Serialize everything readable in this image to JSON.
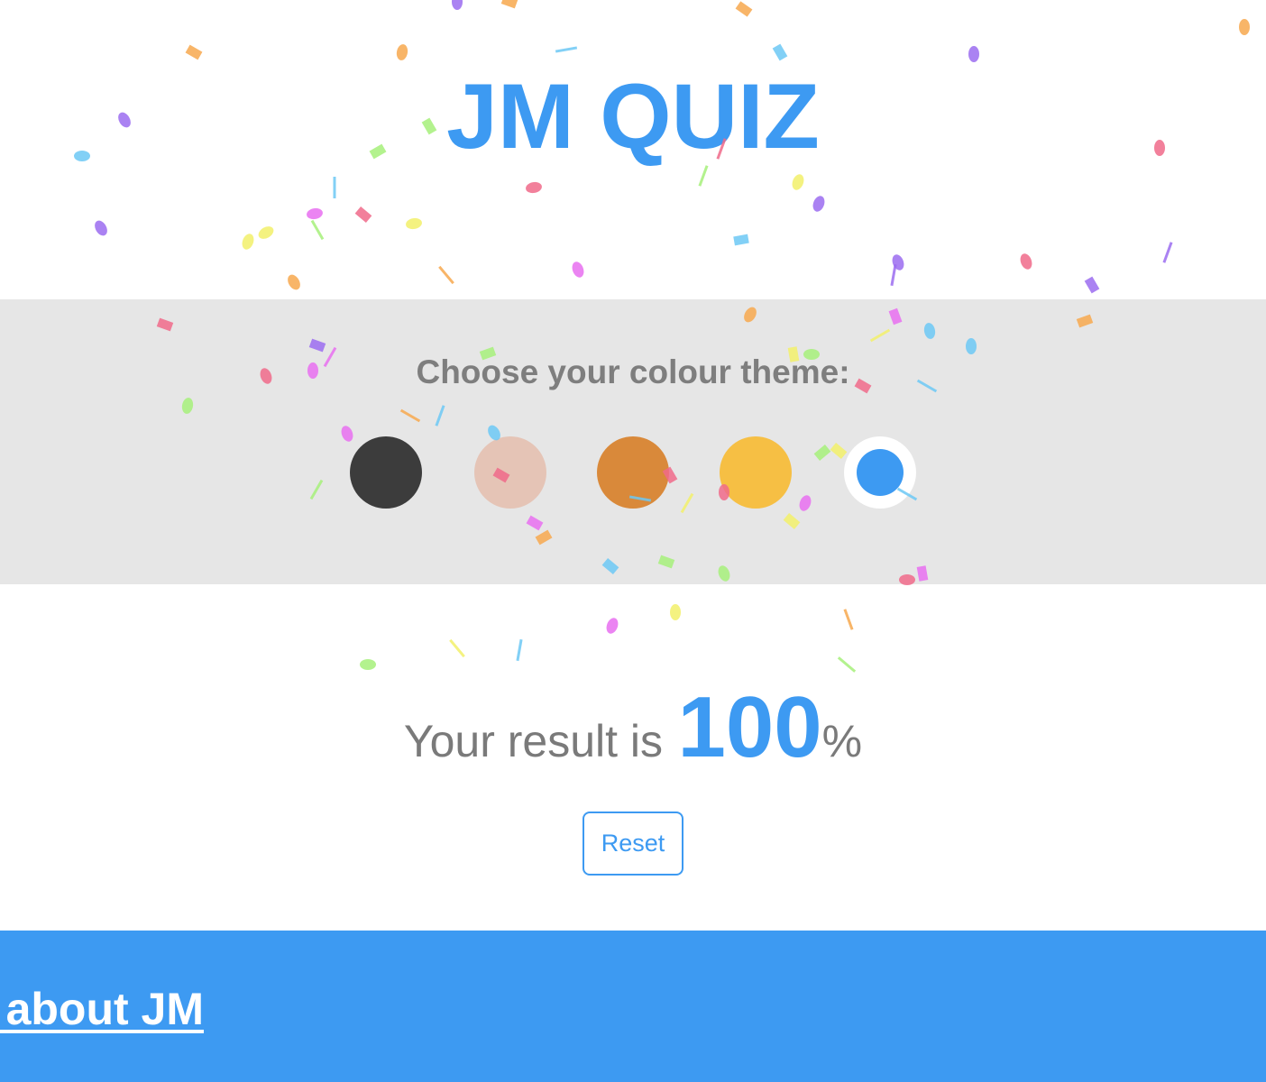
{
  "app": {
    "title": "JM QUIZ"
  },
  "theme_picker": {
    "heading": "Choose your colour theme:",
    "options": [
      {
        "name": "dark",
        "color": "#3c3c3c",
        "selected": false
      },
      {
        "name": "peach",
        "color": "#e5c4b6",
        "selected": false
      },
      {
        "name": "orange",
        "color": "#d9893a",
        "selected": false
      },
      {
        "name": "yellow",
        "color": "#f6bf44",
        "selected": false
      },
      {
        "name": "blue",
        "color": "#3d9af2",
        "selected": true
      }
    ]
  },
  "result": {
    "prefix": "Your result is",
    "score": "100",
    "suffix": "%"
  },
  "actions": {
    "reset_label": "Reset"
  },
  "footer": {
    "link_text": "Find out about JM"
  },
  "colors": {
    "accent": "#3d9af2",
    "band": "#e6e6e6",
    "muted_text": "#7e7e7e"
  },
  "decoration": {
    "icon": "confetti-icon",
    "palette": [
      "#f7a84d",
      "#9b6cf0",
      "#6cc8f5",
      "#f06a8a",
      "#f2f06a",
      "#a6f07a",
      "#e86ef0"
    ]
  }
}
